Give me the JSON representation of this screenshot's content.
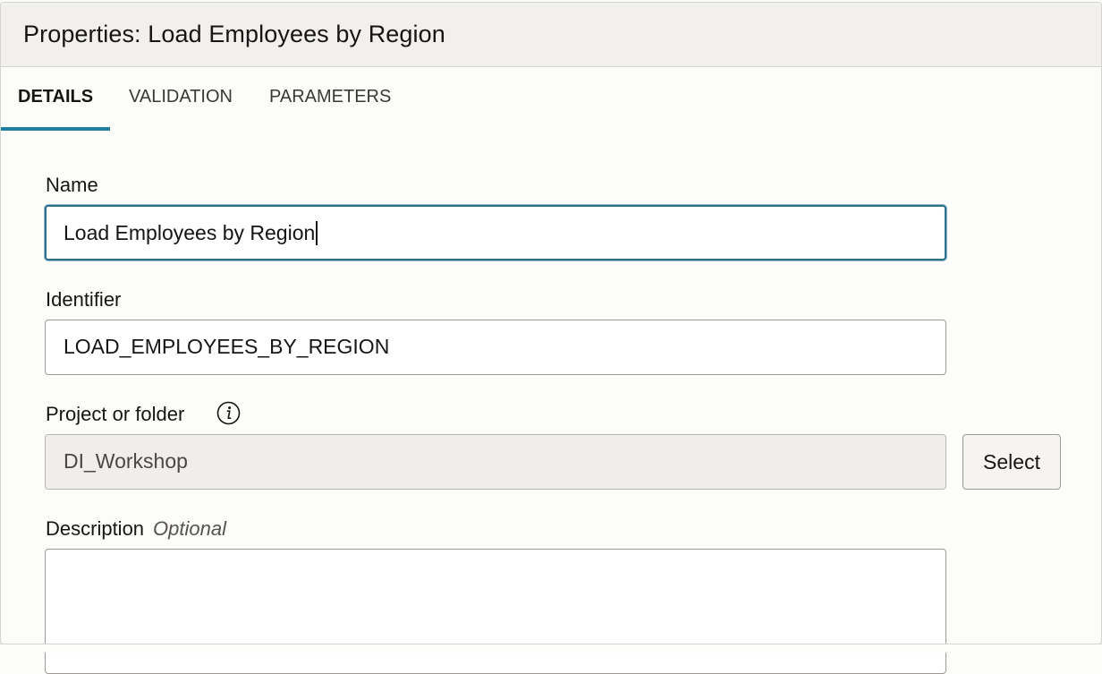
{
  "header": {
    "title": "Properties: Load Employees by Region"
  },
  "tabs": [
    {
      "label": "DETAILS",
      "active": true
    },
    {
      "label": "VALIDATION",
      "active": false
    },
    {
      "label": "PARAMETERS",
      "active": false
    }
  ],
  "form": {
    "name": {
      "label": "Name",
      "value": "Load Employees by Region"
    },
    "identifier": {
      "label": "Identifier",
      "value": "LOAD_EMPLOYEES_BY_REGION"
    },
    "project_or_folder": {
      "label": "Project or folder",
      "info_icon": "info-icon",
      "value": "DI_Workshop",
      "select_label": "Select"
    },
    "description": {
      "label": "Description",
      "optional_label": "Optional",
      "value": ""
    }
  },
  "colors": {
    "accent_tab_underline": "#227e9e",
    "focused_border": "#2b6f8a",
    "header_background": "#f1f0ef",
    "readonly_background": "#efeeed"
  }
}
